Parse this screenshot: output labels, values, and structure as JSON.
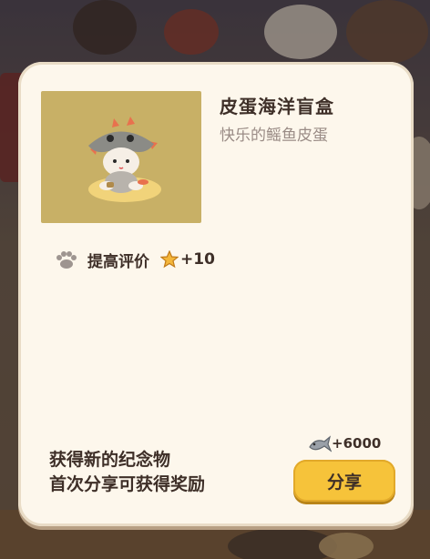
{
  "colors": {
    "card_bg": "#fdf7ec",
    "title_text": "#3e2f28",
    "subtitle_text": "#9a8c86",
    "button_bg": "#f6c33a",
    "thumb_bg": "#c8b066"
  },
  "item": {
    "title": "皮蛋海洋盲盒",
    "subtitle": "快乐的鳐鱼皮蛋",
    "image_icon": "cat-in-ray-hat-icon"
  },
  "reward": {
    "icon": "paw-icon",
    "label": "提高评价",
    "star_icon": "star-icon",
    "value": "+10"
  },
  "footer": {
    "line1": "获得新的纪念物",
    "line2": "首次分享可获得奖励"
  },
  "share_reward": {
    "icon": "fish-icon",
    "amount": "+6000"
  },
  "share_button": {
    "label": "分享"
  }
}
